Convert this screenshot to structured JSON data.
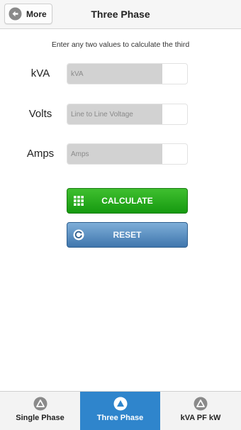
{
  "header": {
    "more_label": "More",
    "more_icon": "back-circle-icon",
    "title": "Three Phase"
  },
  "instructions": "Enter any two values to calculate the third",
  "fields": [
    {
      "label": "kVA",
      "placeholder": "kVA",
      "value": ""
    },
    {
      "label": "Volts",
      "placeholder": "Line to Line Voltage",
      "value": ""
    },
    {
      "label": "Amps",
      "placeholder": "Amps",
      "value": ""
    }
  ],
  "buttons": {
    "calculate": {
      "label": "CALCULATE",
      "icon": "calculator-grid-icon",
      "color": "#169a10"
    },
    "reset": {
      "label": "RESET",
      "icon": "refresh-icon",
      "color": "#3f76ad"
    }
  },
  "tabs": [
    {
      "label": "Single Phase",
      "icon": "triangle-circle-icon",
      "active": false
    },
    {
      "label": "Three Phase",
      "icon": "triangle-circle-icon",
      "active": true
    },
    {
      "label": "kVA PF kW",
      "icon": "triangle-circle-icon",
      "active": false
    }
  ],
  "colors": {
    "active_tab": "#2f85cc",
    "header_bg": "#f6f6f6"
  }
}
